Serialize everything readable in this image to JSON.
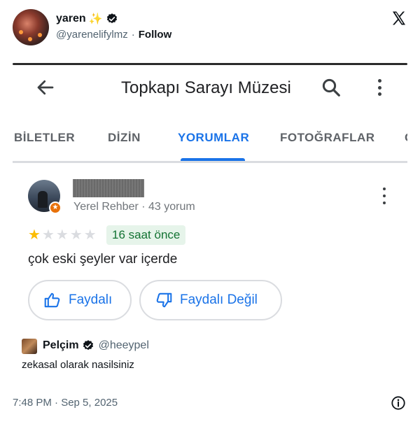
{
  "tweet": {
    "author_name": "yaren",
    "author_emoji": "✨",
    "handle": "@yarenelifylmz",
    "separator": "·",
    "follow_label": "Follow",
    "timestamp": "7:48 PM · Sep 5, 2025",
    "icons": {
      "brand": "x-logo-icon",
      "verified": "verified-badge-icon",
      "info": "info-icon"
    }
  },
  "screenshot": {
    "app_bar": {
      "title": "Topkapı Sarayı Müzesi",
      "icons": [
        "back-arrow-icon",
        "search-icon",
        "more-vert-icon"
      ]
    },
    "tabs": [
      {
        "label": "BİLETLER",
        "active": false
      },
      {
        "label": "DİZİN",
        "active": false
      },
      {
        "label": "YORUMLAR",
        "active": true
      },
      {
        "label": "FOTOĞRAFLAR",
        "active": false
      },
      {
        "label": "G",
        "active": false
      }
    ],
    "review": {
      "reviewer_meta": "Yerel Rehber · 43 yorum",
      "rating": 1,
      "rating_max": 5,
      "time_ago": "16 saat önce",
      "text": "çok eski şeyler var içerde",
      "helpful_label": "Faydalı",
      "not_helpful_label": "Faydalı Değil"
    },
    "colors": {
      "accent": "#1a73e8",
      "star": "#fbbc04",
      "chip_bg": "#e6f4ea",
      "chip_text": "#137333"
    }
  },
  "quoted": {
    "name": "Pelçim",
    "handle": "@heeypel",
    "text": "zekasal olarak nasilsiniz"
  }
}
